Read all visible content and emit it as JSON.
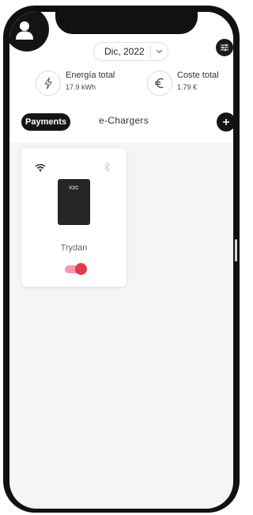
{
  "header": {
    "date_label": "Dic, 2022"
  },
  "stats": {
    "energy": {
      "label": "Energía total",
      "value": "17.9 kWh"
    },
    "cost": {
      "label": "Coste total",
      "value": "1.79 €"
    }
  },
  "tabs": {
    "payments_label": "Payments",
    "chargers_label": "e-Chargers"
  },
  "charger": {
    "device_logo": "V2C",
    "name": "Trydan",
    "enabled": true
  },
  "colors": {
    "accent": "#e03a4e",
    "accent_track": "#f19aa6",
    "dark": "#151515"
  },
  "icons": {
    "profile": "user-icon",
    "date_dropdown": "chevron-down-icon",
    "filter": "sliders-icon",
    "energy": "lightning-bolt-icon",
    "cost": "euro-icon",
    "add": "plus-icon",
    "wifi": "wifi-icon",
    "bluetooth": "bluetooth-icon"
  }
}
